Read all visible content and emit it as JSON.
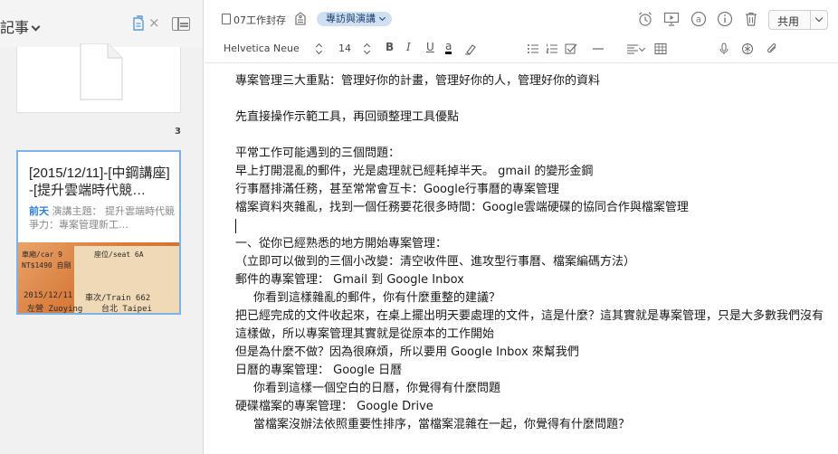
{
  "note_list": {
    "header_title": "記事",
    "icons": {
      "shortcut": "shortcut-icon",
      "close": "close-icon",
      "view_toggle": "card-view-icon"
    },
    "close_glyph": "×",
    "count": "3",
    "cards": [
      {
        "kind": "attachment-preview",
        "icon": "document-icon"
      },
      {
        "title": "[2015/12/11]-[中鋼講座]-[提升雲端時代競…",
        "date": "前天",
        "snippet": "演講主題： 提升雲端時代競爭力：專案管理新工…",
        "thumbnail": {
          "lines": [
            "車廂/car 9",
            "座位/seat 6A",
            "NT$1490 自剛",
            "2015/12/11",
            "車次/Train 662",
            "左營 Zuoying",
            "台北 Taipei"
          ]
        }
      }
    ]
  },
  "editor": {
    "notebook": "07工作封存",
    "tag": "專訪與演講",
    "toolbar_icons": [
      "reminder-icon",
      "present-icon",
      "at-icon",
      "info-icon",
      "trash-icon"
    ],
    "share_label": "共用",
    "format": {
      "font": "Helvetica Neue",
      "size": "14",
      "bold": "B",
      "italic": "I",
      "underline": "U",
      "text_color": "a",
      "icons": [
        "highlight-icon",
        "bullet-list-icon",
        "numbered-list-icon",
        "checkbox-icon",
        "divider-icon",
        "align-icon",
        "table-icon",
        "record-icon",
        "encrypt-icon",
        "attach-icon"
      ]
    },
    "body": [
      {
        "text": "專案管理三大重點：管理好你的計畫，管理好你的人，管理好你的資料"
      },
      {
        "text": ""
      },
      {
        "text": "先直接操作示範工具，再回頭整理工具優點"
      },
      {
        "text": ""
      },
      {
        "text": "平常工作可能遇到的三個問題："
      },
      {
        "text": "早上打開混亂的郵件，光是處理就已經耗掉半天。 gmail 的變形金鋼"
      },
      {
        "text": "行事曆排滿任務，甚至常常會互卡：Google行事曆的專案管理"
      },
      {
        "text": "檔案資料夾雜亂，找到一個任務要花很多時間：Google雲端硬碟的協同合作與檔案管理"
      },
      {
        "text": "",
        "caret": true
      },
      {
        "text": "一、從你已經熟悉的地方開始專案管理："
      },
      {
        "text": "（立即可以做到的三個小改變：清空收件匣、進攻型行事曆、檔案編碼方法）"
      },
      {
        "text": "郵件的專案管理： Gmail 到 Google Inbox"
      },
      {
        "text": "你看到這樣雜亂的郵件，你有什麼重整的建議？",
        "indent": true
      },
      {
        "text": "把已經完成的文件收起來，在桌上擺出明天要處理的文件，這是什麼？這其實就是專案管理，只是大多數我們沒有這樣做，所以專案管理其實就是從原本的工作開始",
        "wrap": true
      },
      {
        "text": "但是為什麼不做？因為很麻煩，所以要用 Google Inbox 來幫我們"
      },
      {
        "text": "日曆的專案管理： Google 日曆"
      },
      {
        "text": "你看到這樣一個空白的日曆，你覺得有什麼問題",
        "indent": true
      },
      {
        "text": "硬碟檔案的專案管理： Google Drive"
      },
      {
        "text": "當檔案沒辦法依照重要性排序，當檔案混雜在一起，你覺得有什麼問題？",
        "indent": true
      }
    ]
  }
}
